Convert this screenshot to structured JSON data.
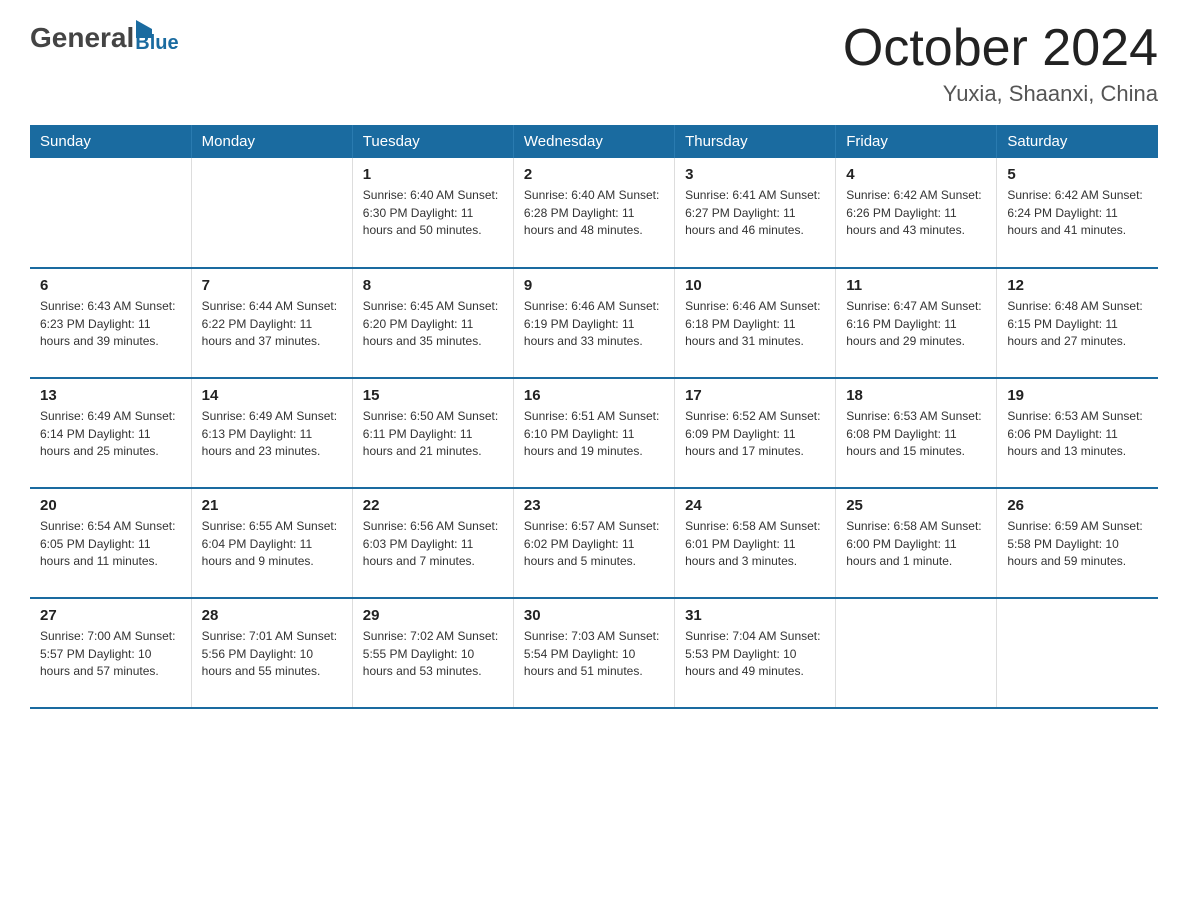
{
  "header": {
    "logo_general": "General",
    "logo_blue": "Blue",
    "month_title": "October 2024",
    "location": "Yuxia, Shaanxi, China"
  },
  "days_of_week": [
    "Sunday",
    "Monday",
    "Tuesday",
    "Wednesday",
    "Thursday",
    "Friday",
    "Saturday"
  ],
  "weeks": [
    [
      {
        "day": "",
        "info": ""
      },
      {
        "day": "",
        "info": ""
      },
      {
        "day": "1",
        "info": "Sunrise: 6:40 AM\nSunset: 6:30 PM\nDaylight: 11 hours\nand 50 minutes."
      },
      {
        "day": "2",
        "info": "Sunrise: 6:40 AM\nSunset: 6:28 PM\nDaylight: 11 hours\nand 48 minutes."
      },
      {
        "day": "3",
        "info": "Sunrise: 6:41 AM\nSunset: 6:27 PM\nDaylight: 11 hours\nand 46 minutes."
      },
      {
        "day": "4",
        "info": "Sunrise: 6:42 AM\nSunset: 6:26 PM\nDaylight: 11 hours\nand 43 minutes."
      },
      {
        "day": "5",
        "info": "Sunrise: 6:42 AM\nSunset: 6:24 PM\nDaylight: 11 hours\nand 41 minutes."
      }
    ],
    [
      {
        "day": "6",
        "info": "Sunrise: 6:43 AM\nSunset: 6:23 PM\nDaylight: 11 hours\nand 39 minutes."
      },
      {
        "day": "7",
        "info": "Sunrise: 6:44 AM\nSunset: 6:22 PM\nDaylight: 11 hours\nand 37 minutes."
      },
      {
        "day": "8",
        "info": "Sunrise: 6:45 AM\nSunset: 6:20 PM\nDaylight: 11 hours\nand 35 minutes."
      },
      {
        "day": "9",
        "info": "Sunrise: 6:46 AM\nSunset: 6:19 PM\nDaylight: 11 hours\nand 33 minutes."
      },
      {
        "day": "10",
        "info": "Sunrise: 6:46 AM\nSunset: 6:18 PM\nDaylight: 11 hours\nand 31 minutes."
      },
      {
        "day": "11",
        "info": "Sunrise: 6:47 AM\nSunset: 6:16 PM\nDaylight: 11 hours\nand 29 minutes."
      },
      {
        "day": "12",
        "info": "Sunrise: 6:48 AM\nSunset: 6:15 PM\nDaylight: 11 hours\nand 27 minutes."
      }
    ],
    [
      {
        "day": "13",
        "info": "Sunrise: 6:49 AM\nSunset: 6:14 PM\nDaylight: 11 hours\nand 25 minutes."
      },
      {
        "day": "14",
        "info": "Sunrise: 6:49 AM\nSunset: 6:13 PM\nDaylight: 11 hours\nand 23 minutes."
      },
      {
        "day": "15",
        "info": "Sunrise: 6:50 AM\nSunset: 6:11 PM\nDaylight: 11 hours\nand 21 minutes."
      },
      {
        "day": "16",
        "info": "Sunrise: 6:51 AM\nSunset: 6:10 PM\nDaylight: 11 hours\nand 19 minutes."
      },
      {
        "day": "17",
        "info": "Sunrise: 6:52 AM\nSunset: 6:09 PM\nDaylight: 11 hours\nand 17 minutes."
      },
      {
        "day": "18",
        "info": "Sunrise: 6:53 AM\nSunset: 6:08 PM\nDaylight: 11 hours\nand 15 minutes."
      },
      {
        "day": "19",
        "info": "Sunrise: 6:53 AM\nSunset: 6:06 PM\nDaylight: 11 hours\nand 13 minutes."
      }
    ],
    [
      {
        "day": "20",
        "info": "Sunrise: 6:54 AM\nSunset: 6:05 PM\nDaylight: 11 hours\nand 11 minutes."
      },
      {
        "day": "21",
        "info": "Sunrise: 6:55 AM\nSunset: 6:04 PM\nDaylight: 11 hours\nand 9 minutes."
      },
      {
        "day": "22",
        "info": "Sunrise: 6:56 AM\nSunset: 6:03 PM\nDaylight: 11 hours\nand 7 minutes."
      },
      {
        "day": "23",
        "info": "Sunrise: 6:57 AM\nSunset: 6:02 PM\nDaylight: 11 hours\nand 5 minutes."
      },
      {
        "day": "24",
        "info": "Sunrise: 6:58 AM\nSunset: 6:01 PM\nDaylight: 11 hours\nand 3 minutes."
      },
      {
        "day": "25",
        "info": "Sunrise: 6:58 AM\nSunset: 6:00 PM\nDaylight: 11 hours\nand 1 minute."
      },
      {
        "day": "26",
        "info": "Sunrise: 6:59 AM\nSunset: 5:58 PM\nDaylight: 10 hours\nand 59 minutes."
      }
    ],
    [
      {
        "day": "27",
        "info": "Sunrise: 7:00 AM\nSunset: 5:57 PM\nDaylight: 10 hours\nand 57 minutes."
      },
      {
        "day": "28",
        "info": "Sunrise: 7:01 AM\nSunset: 5:56 PM\nDaylight: 10 hours\nand 55 minutes."
      },
      {
        "day": "29",
        "info": "Sunrise: 7:02 AM\nSunset: 5:55 PM\nDaylight: 10 hours\nand 53 minutes."
      },
      {
        "day": "30",
        "info": "Sunrise: 7:03 AM\nSunset: 5:54 PM\nDaylight: 10 hours\nand 51 minutes."
      },
      {
        "day": "31",
        "info": "Sunrise: 7:04 AM\nSunset: 5:53 PM\nDaylight: 10 hours\nand 49 minutes."
      },
      {
        "day": "",
        "info": ""
      },
      {
        "day": "",
        "info": ""
      }
    ]
  ]
}
